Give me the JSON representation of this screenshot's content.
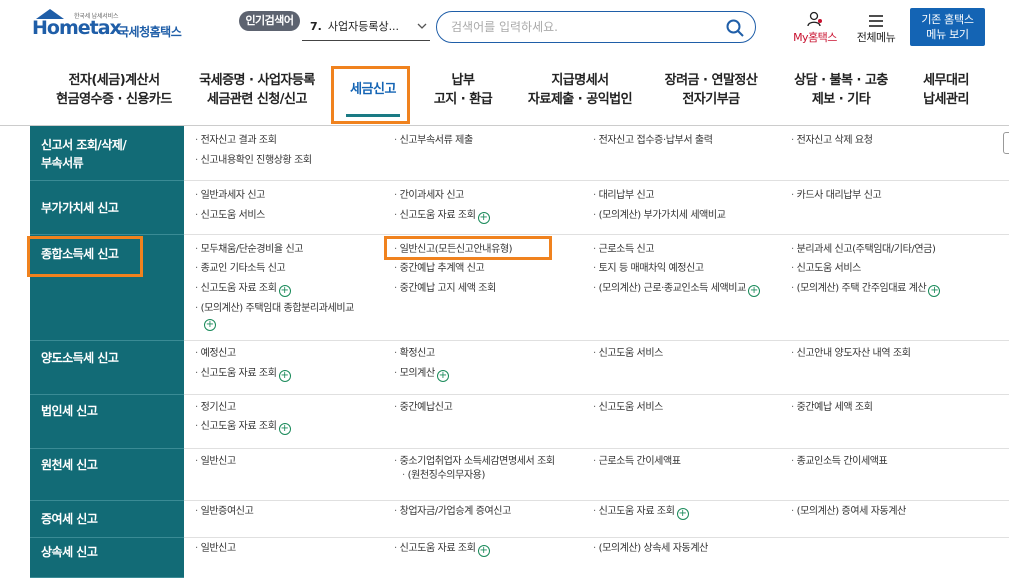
{
  "header": {
    "logo_small": "한국세 납세서비스",
    "logo_name": "Hometax",
    "logo_kr": "국세청홈택스",
    "popular_label": "인기검색어",
    "popular_num": "7.",
    "popular_value": "사업자등록상...",
    "search_placeholder": "검색어를 입력하세요.",
    "my_hometax": "My홈택스",
    "all_menu": "전체메뉴",
    "old_menu_line1": "기존 홈택스",
    "old_menu_line2": "메뉴 보기"
  },
  "nav": [
    {
      "l1": "전자(세금)계산서",
      "l2": "현금영수증 · 신용카드"
    },
    {
      "l1": "국세증명 · 사업자등록",
      "l2": "세금관련 신청/신고"
    },
    {
      "l1": "세금신고",
      "l2": ""
    },
    {
      "l1": "납부",
      "l2": "고지 · 환급"
    },
    {
      "l1": "지급명세서",
      "l2": "자료제출 · 공익법인"
    },
    {
      "l1": "장려금 · 연말정산",
      "l2": "전자기부금"
    },
    {
      "l1": "상담 · 불복 · 고충",
      "l2": "제보 · 기타"
    },
    {
      "l1": "세무대리",
      "l2": "납세관리"
    }
  ],
  "rows": [
    {
      "head": [
        "신고서 조회/삭제/",
        "부속서류"
      ],
      "cells": [
        "전자신고 결과 조회",
        "신고부속서류 제출",
        "전자신고 접수증·납부서 출력",
        "전자신고 삭제 요청",
        "신고내용확인 진행상황 조회"
      ]
    },
    {
      "head": [
        "부가가치세 신고"
      ],
      "cells": [
        "일반과세자 신고",
        "간이과세자 신고",
        "대리납부 신고",
        "카드사 대리납부 신고",
        "신고도움 서비스",
        "신고도움 자료 조회",
        "(모의계산) 부가가치세 세액비교"
      ]
    },
    {
      "head": [
        "종합소득세 신고"
      ],
      "cells": [
        "모두채움/단순경비율 신고",
        "일반신고(모든신고안내유형)",
        "근로소득 신고",
        "분리과세 신고(주택임대/기타/연금)",
        "종교인 기타소득 신고",
        "중간예납 추계액 신고",
        "토지 등 매매차익 예정신고",
        "신고도움 서비스",
        "신고도움 자료 조회",
        "중간예납 고지 세액 조회",
        "(모의계산) 근로·종교인소득 세액비교",
        "(모의계산) 주택 간주임대료 계산",
        "(모의계산) 주택임대 종합분리과세비교"
      ]
    },
    {
      "head": [
        "양도소득세 신고"
      ],
      "cells": [
        "예정신고",
        "확정신고",
        "신고도움 서비스",
        "신고안내 양도자산 내역 조회",
        "신고도움 자료 조회",
        "모의계산"
      ]
    },
    {
      "head": [
        "법인세 신고"
      ],
      "cells": [
        "정기신고",
        "중간예납신고",
        "신고도움 서비스",
        "중간예납 세액 조회",
        "신고도움 자료 조회"
      ]
    },
    {
      "head": [
        "원천세 신고"
      ],
      "cells": [
        "일반신고",
        "중소기업취업자 소득세감면명세서 조회",
        "(원천징수의무자용)",
        "근로소득 간이세액표",
        "종교인소득 간이세액표"
      ]
    },
    {
      "head": [
        "증여세 신고"
      ],
      "cells": [
        "일반증여신고",
        "창업자금/가업승계 증여신고",
        "신고도움 자료 조회",
        "(모의계산) 증여세 자동계산"
      ]
    },
    {
      "head": [
        "상속세 신고"
      ],
      "cells": [
        "일반신고",
        "신고도움 자료 조회",
        "(모의계산) 상속세 자동계산"
      ]
    }
  ],
  "colors": {
    "teal": "#126b76",
    "accent_blue": "#1464b4",
    "highlight_orange": "#f0821e",
    "my_red": "#c8102e"
  },
  "icons": [
    "search-icon",
    "user-icon",
    "hamburger-icon",
    "plus-circle-icon"
  ]
}
